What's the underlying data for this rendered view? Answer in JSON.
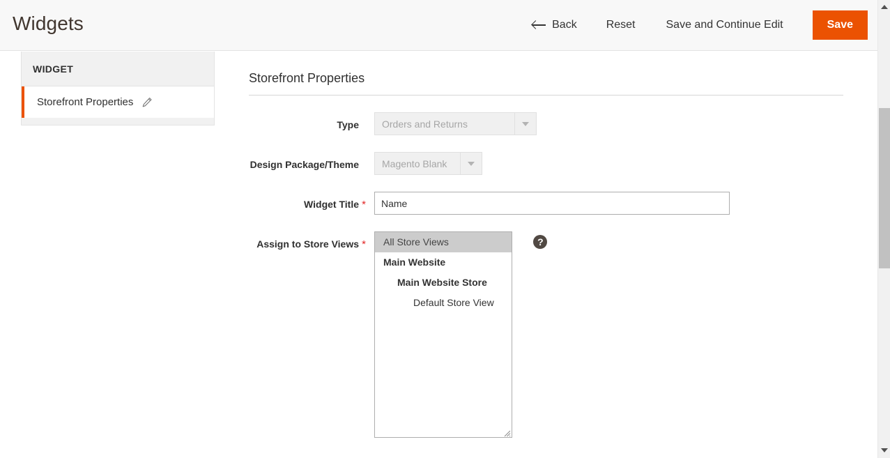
{
  "header": {
    "title": "Widgets",
    "actions": {
      "back_label": "Back",
      "back_icon": "arrow-left-icon",
      "reset_label": "Reset",
      "save_continue_label": "Save and Continue Edit",
      "save_label": "Save"
    },
    "accent_color": "#eb5202"
  },
  "sidebar": {
    "section_title": "WIDGET",
    "items": [
      {
        "label": "Storefront Properties",
        "icon": "pencil-icon",
        "active": true
      }
    ]
  },
  "main": {
    "section_title": "Storefront Properties",
    "fields": {
      "type": {
        "label": "Type",
        "value": "Orders and Returns",
        "disabled": true,
        "required": false,
        "icon": "chevron-down-icon"
      },
      "design_theme": {
        "label": "Design Package/Theme",
        "value": "Magento Blank",
        "disabled": true,
        "required": false,
        "icon": "chevron-down-icon"
      },
      "widget_title": {
        "label": "Widget Title",
        "value": "Name",
        "placeholder": "Name",
        "required": true
      },
      "store_views": {
        "label": "Assign to Store Views",
        "required": true,
        "help_icon": "question-mark-icon",
        "options": [
          {
            "label": "All Store Views",
            "level": "all",
            "selected": true
          },
          {
            "label": "Main Website",
            "level": "website",
            "selected": false
          },
          {
            "label": "Main Website Store",
            "level": "store",
            "selected": false
          },
          {
            "label": "Default Store View",
            "level": "view",
            "selected": false
          }
        ]
      }
    }
  },
  "scrollbar": {
    "up_icon": "triangle-up-icon",
    "down_icon": "triangle-down-icon",
    "orientation": "vertical"
  }
}
